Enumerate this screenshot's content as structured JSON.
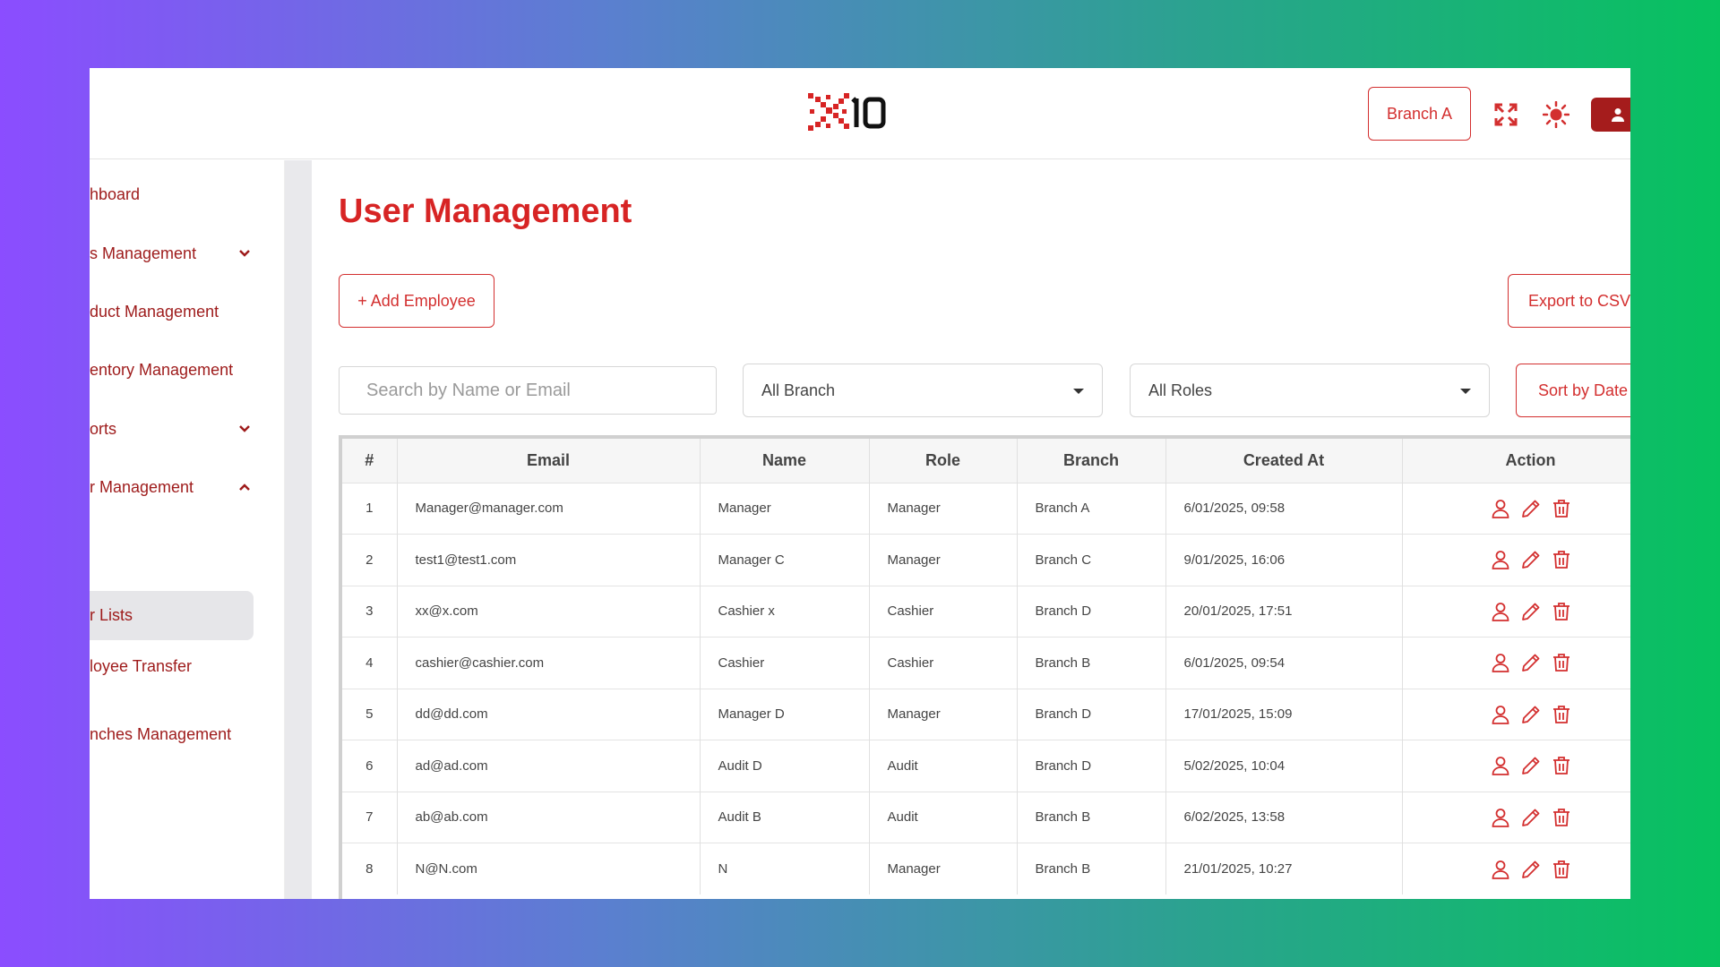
{
  "header": {
    "branch_label": "Branch A"
  },
  "sidebar": {
    "items": [
      {
        "label": "hboard"
      },
      {
        "label": "s Management"
      },
      {
        "label": "duct Management"
      },
      {
        "label": "entory Management"
      },
      {
        "label": "orts"
      },
      {
        "label": "r Management"
      },
      {
        "label": "r Lists"
      },
      {
        "label": "loyee Transfer"
      },
      {
        "label": "nches Management"
      }
    ]
  },
  "main": {
    "title": "User Management",
    "add_label": "+ Add Employee",
    "export_label": "Export to CSV",
    "sort_label": "Sort by Date",
    "search_placeholder": "Search by Name or Email",
    "branch_filter": "All Branch",
    "roles_filter": "All Roles"
  },
  "table": {
    "headers": [
      "#",
      "Email",
      "Name",
      "Role",
      "Branch",
      "Created At",
      "Action"
    ],
    "rows": [
      [
        "1",
        "Manager@manager.com",
        "Manager",
        "Manager",
        "Branch A",
        "6/01/2025, 09:58"
      ],
      [
        "2",
        "test1@test1.com",
        "Manager C",
        "Manager",
        "Branch C",
        "9/01/2025, 16:06"
      ],
      [
        "3",
        "xx@x.com",
        "Cashier x",
        "Cashier",
        "Branch D",
        "20/01/2025, 17:51"
      ],
      [
        "4",
        "cashier@cashier.com",
        "Cashier",
        "Cashier",
        "Branch B",
        "6/01/2025, 09:54"
      ],
      [
        "5",
        "dd@dd.com",
        "Manager D",
        "Manager",
        "Branch D",
        "17/01/2025, 15:09"
      ],
      [
        "6",
        "ad@ad.com",
        "Audit D",
        "Audit",
        "Branch D",
        "5/02/2025, 10:04"
      ],
      [
        "7",
        "ab@ab.com",
        "Audit B",
        "Audit",
        "Branch B",
        "6/02/2025, 13:58"
      ],
      [
        "8",
        "N@N.com",
        "N",
        "Manager",
        "Branch B",
        "21/01/2025, 10:27"
      ]
    ]
  },
  "colors": {
    "accent": "#d32f2f",
    "dark_accent": "#a51c1c"
  }
}
